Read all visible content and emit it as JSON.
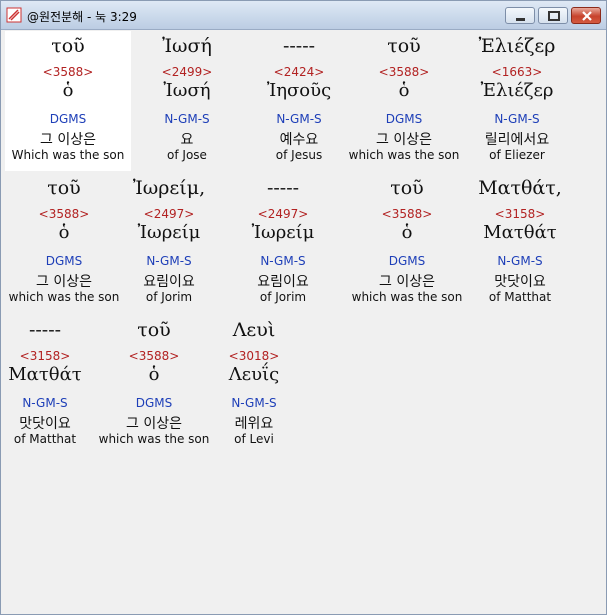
{
  "window": {
    "title": "@원전분해 - 눅 3:29"
  },
  "rows": [
    [
      {
        "word": "τοῦ",
        "strong": "<3588>",
        "lemma": "ὁ",
        "morph": "DGMS",
        "korean": "그 이상은",
        "english": "Which was the son"
      },
      {
        "word": "Ἰωσή",
        "strong": "<2499>",
        "lemma": "Ἰωσή",
        "morph": "N-GM-S",
        "korean": "요",
        "english": "of Jose"
      },
      {
        "word": "-----",
        "strong": "<2424>",
        "lemma": "Ἰησοῦς",
        "morph": "N-GM-S",
        "korean": "예수요",
        "english": "of Jesus"
      },
      {
        "word": "τοῦ",
        "strong": "<3588>",
        "lemma": "ὁ",
        "morph": "DGMS",
        "korean": "그 이상은",
        "english": "which was the son"
      },
      {
        "word": "Ἐλιέζερ",
        "strong": "<1663>",
        "lemma": "Ἐλιέζερ",
        "morph": "N-GM-S",
        "korean": "릴리에서요",
        "english": "of Eliezer"
      }
    ],
    [
      {
        "word": "τοῦ",
        "strong": "<3588>",
        "lemma": "ὁ",
        "morph": "DGMS",
        "korean": "그 이상은",
        "english": "which was the son"
      },
      {
        "word": "Ἰωρείμ,",
        "strong": "<2497>",
        "lemma": "Ἰωρείμ",
        "morph": "N-GM-S",
        "korean": "요림이요",
        "english": "of Jorim"
      },
      {
        "word": "-----",
        "strong": "<2497>",
        "lemma": "Ἰωρείμ",
        "morph": "N-GM-S",
        "korean": "요림이요",
        "english": "of Jorim"
      },
      {
        "word": "τοῦ",
        "strong": "<3588>",
        "lemma": "ὁ",
        "morph": "DGMS",
        "korean": "그 이상은",
        "english": "which was the son"
      },
      {
        "word": "Ματθάτ,",
        "strong": "<3158>",
        "lemma": "Ματθάτ",
        "morph": "N-GM-S",
        "korean": "맛닷이요",
        "english": "of Matthat"
      }
    ],
    [
      {
        "word": "-----",
        "strong": "<3158>",
        "lemma": "Ματθάτ",
        "morph": "N-GM-S",
        "korean": "맛닷이요",
        "english": "of Matthat"
      },
      {
        "word": "τοῦ",
        "strong": "<3588>",
        "lemma": "ὁ",
        "morph": "DGMS",
        "korean": "그 이상은",
        "english": "which was the son"
      },
      {
        "word": "Λευὶ",
        "strong": "<3018>",
        "lemma": "Λευΐς",
        "morph": "N-GM-S",
        "korean": "레위요",
        "english": "of Levi"
      }
    ]
  ]
}
